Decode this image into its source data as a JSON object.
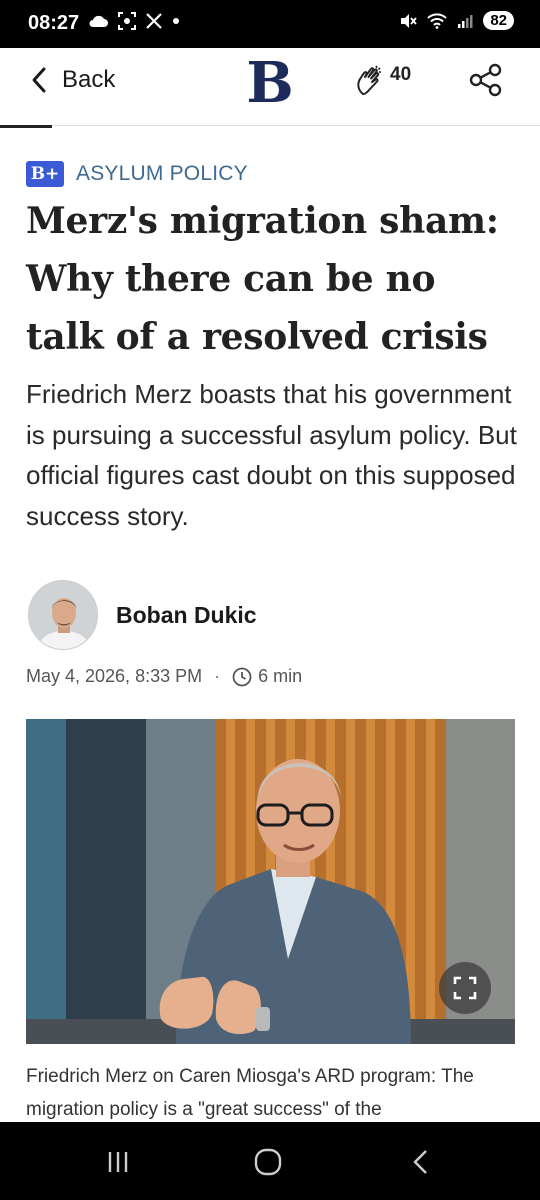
{
  "status_bar": {
    "time": "08:27",
    "battery": "82",
    "left_icons": [
      "cloud-icon",
      "screenshot-icon",
      "x-icon",
      "dot-icon"
    ],
    "right_icons": [
      "mute-icon",
      "wifi-icon",
      "signal-icon"
    ]
  },
  "app_bar": {
    "back_label": "Back",
    "logo_letter": "B",
    "clap_count": "40",
    "icons": [
      "chevron-left-icon",
      "clap-icon",
      "share-icon"
    ]
  },
  "article": {
    "kicker_badge": "B+",
    "kicker": "ASYLUM POLICY",
    "headline": "Merz's migration sham: Why there can be no talk of a resolved crisis",
    "teaser": "Friedrich Merz boasts that his government is pursuing a successful asylum policy. But official figures cast doubt on this supposed success story.",
    "author": "Boban Dukic",
    "date": "May 4, 2026, 8:33 PM",
    "separator": "·",
    "read_time": "6 min",
    "caption": "Friedrich Merz on Caren Miosga's ARD program: The migration policy is a \"great success\" of the"
  },
  "colors": {
    "accent_blue": "#3b5bd6",
    "kicker_text": "#3f6a8f",
    "logo_navy": "#1c2b5a"
  }
}
